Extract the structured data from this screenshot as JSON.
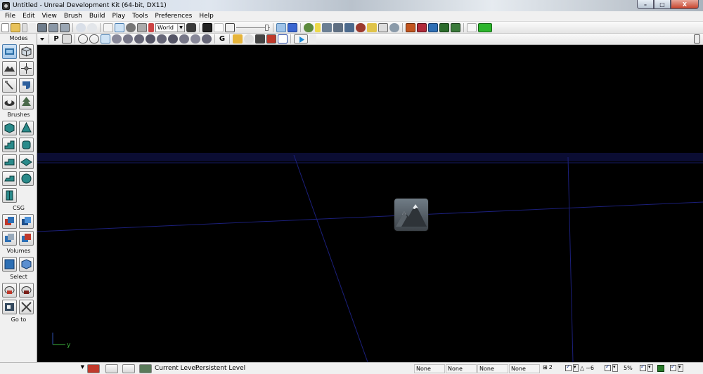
{
  "window": {
    "title": "Untitled - Unreal Development Kit (64-bit, DX11)",
    "controls": {
      "minimize": "–",
      "maximize": "□",
      "close": "X"
    }
  },
  "menu": {
    "items": [
      "File",
      "Edit",
      "View",
      "Brush",
      "Build",
      "Play",
      "Tools",
      "Preferences",
      "Help"
    ]
  },
  "toolbar": {
    "coord_system": "World",
    "play_icon": "play-in-editor-icon"
  },
  "viewport_toolbar": {
    "perspective_letter": "P",
    "game_letter": "G"
  },
  "sidebar": {
    "sections": {
      "modes": "Modes",
      "brushes": "Brushes",
      "csg": "CSG",
      "volumes": "Volumes",
      "select": "Select",
      "goto": "Go to"
    }
  },
  "viewport": {
    "axis_label": "y",
    "actor_icon": "landscape-mountain-icon",
    "grid_color": "#1b1f7a"
  },
  "statusbar": {
    "current_level_label": "Current Level:",
    "current_level_value": "Persistent Level",
    "fields": [
      "None",
      "None",
      "None",
      "None"
    ],
    "grid_value": "2",
    "rotation_value": "~6",
    "scale_value": "5%"
  },
  "colors": {
    "viewport_background": "#000000",
    "grid_line": "#1b1f7a",
    "play_green": "#2db52d"
  }
}
